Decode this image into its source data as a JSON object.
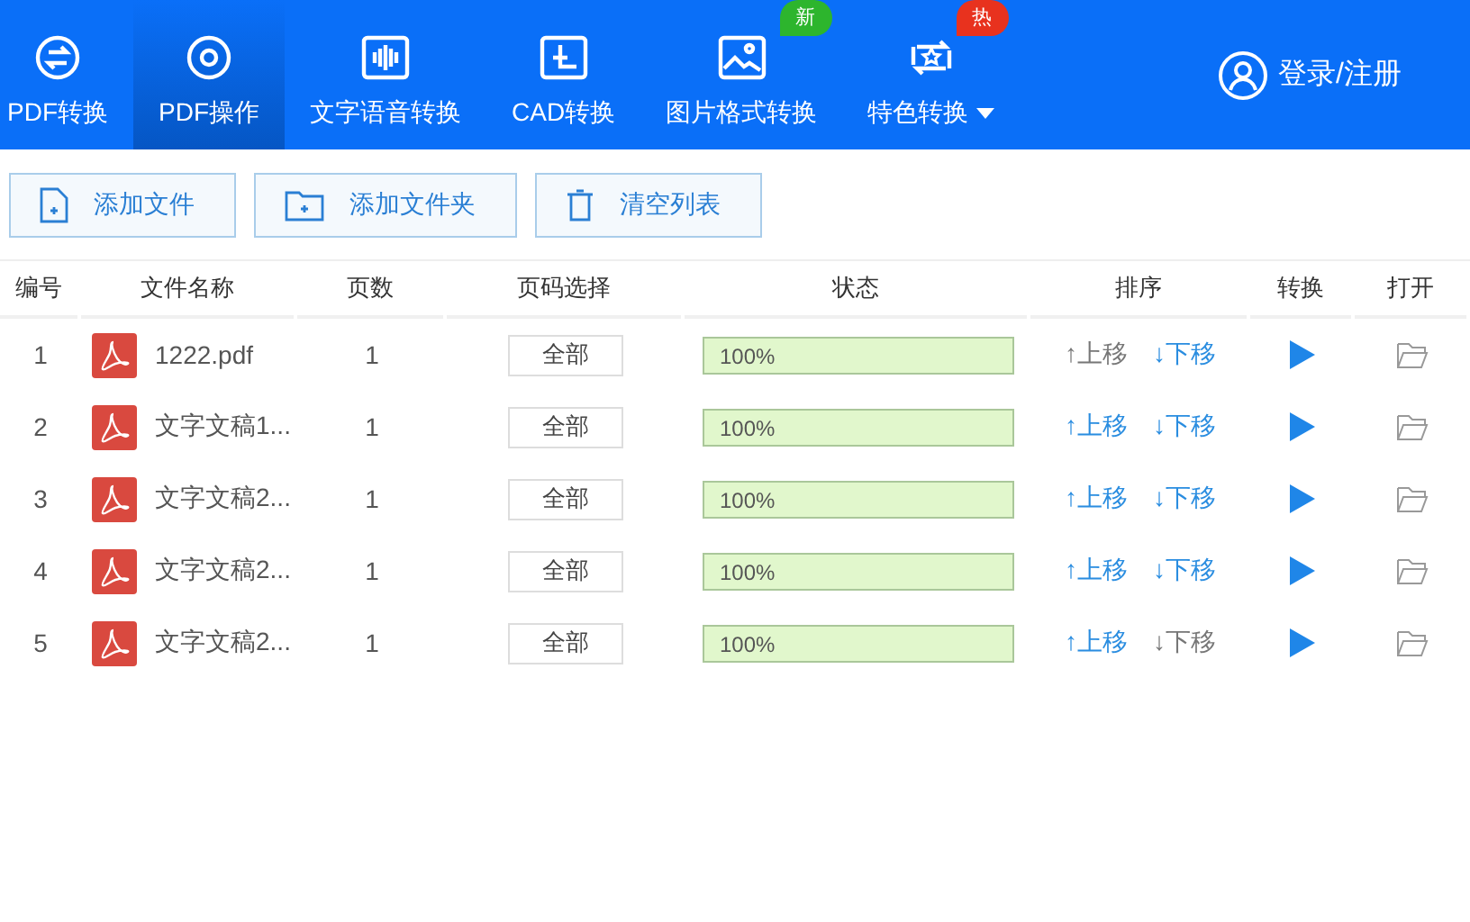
{
  "nav": {
    "tabs": [
      {
        "label": "PDF转换",
        "selected": false
      },
      {
        "label": "PDF操作",
        "selected": true
      },
      {
        "label": "文字语音转换",
        "selected": false
      },
      {
        "label": "CAD转换",
        "selected": false
      },
      {
        "label": "图片格式转换",
        "selected": false,
        "badge": "新",
        "color": "#2db52d"
      },
      {
        "label": "特色转换",
        "selected": false,
        "badge": "热",
        "color": "#e8321e",
        "dropdown": true
      }
    ],
    "login": "登录/注册"
  },
  "toolbar": [
    {
      "label": "添加文件"
    },
    {
      "label": "添加文件夹"
    },
    {
      "label": "清空列表"
    }
  ],
  "table": {
    "columns": [
      "编号",
      "文件名称",
      "页数",
      "页码选择",
      "状态",
      "排序",
      "转换",
      "打开"
    ],
    "rows": [
      {
        "no": "1",
        "name": "1222.pdf",
        "pages": "1",
        "range": "全部",
        "status": "100%",
        "level": 1,
        "up": "↑上移",
        "up_disabled": true,
        "down": "↓下移",
        "down_disabled": false
      },
      {
        "no": "2",
        "name": "文字文稿1...",
        "pages": "1",
        "range": "全部",
        "status": "100%",
        "level": 1,
        "up": "↑上移",
        "up_disabled": false,
        "down": "↓下移",
        "down_disabled": false
      },
      {
        "no": "3",
        "name": "文字文稿2...",
        "pages": "1",
        "range": "全部",
        "status": "100%",
        "level": 1,
        "up": "↑上移",
        "up_disabled": false,
        "down": "↓下移",
        "down_disabled": false
      },
      {
        "no": "4",
        "name": "文字文稿2...",
        "pages": "1",
        "range": "全部",
        "status": "100%",
        "level": 1,
        "up": "↑上移",
        "up_disabled": false,
        "down": "↓下移",
        "down_disabled": false
      },
      {
        "no": "5",
        "name": "文字文稿2...",
        "pages": "1",
        "range": "全部",
        "status": "100%",
        "level": 1,
        "up": "↑上移",
        "up_disabled": false,
        "down": "↓下移",
        "down_disabled": true
      }
    ]
  }
}
